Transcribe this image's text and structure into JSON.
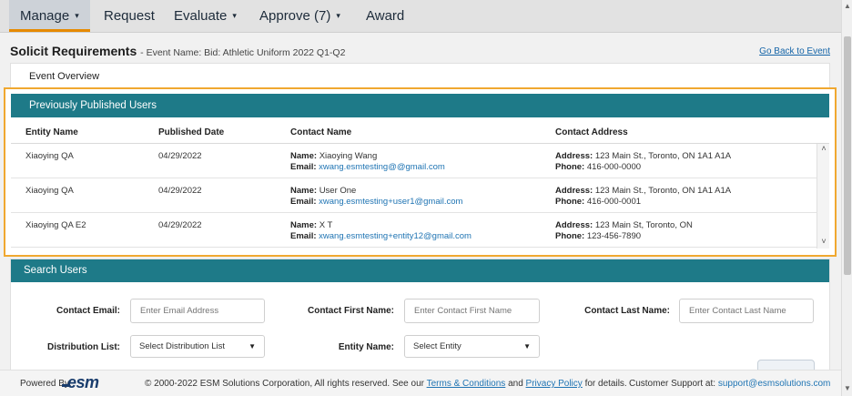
{
  "nav": {
    "items": [
      {
        "label": "Manage",
        "has_caret": true,
        "active": true
      },
      {
        "label": "Request",
        "has_caret": false,
        "active": false
      },
      {
        "label": "Evaluate",
        "has_caret": true,
        "active": false
      },
      {
        "label": "Approve (7)",
        "has_caret": true,
        "active": false
      },
      {
        "label": "Award",
        "has_caret": false,
        "active": false
      }
    ],
    "caret_glyph": "▾"
  },
  "header": {
    "title": "Solicit Requirements",
    "subtitle": "- Event Name: Bid: Athletic Uniform 2022 Q1-Q2",
    "back_link": "Go Back to Event"
  },
  "overview": {
    "label": "Event Overview"
  },
  "published": {
    "title": "Previously Published Users",
    "columns": [
      "Entity Name",
      "Published Date",
      "Contact Name",
      "Contact Address"
    ],
    "name_label": "Name:",
    "email_label": "Email:",
    "address_label": "Address:",
    "phone_label": "Phone:",
    "rows": [
      {
        "entity": "Xiaoying QA",
        "date": "04/29/2022",
        "name": "Xiaoying Wang",
        "email": "xwang.esmtesting@@gmail.com",
        "address": "123 Main St., Toronto, ON 1A1 A1A",
        "phone": "416-000-0000"
      },
      {
        "entity": "Xiaoying QA",
        "date": "04/29/2022",
        "name": "User One",
        "email": "xwang.esmtesting+user1@gmail.com",
        "address": "123 Main St., Toronto, ON 1A1 A1A",
        "phone": "416-000-0001"
      },
      {
        "entity": "Xiaoying QA E2",
        "date": "04/29/2022",
        "name": "X T",
        "email": "xwang.esmtesting+entity12@gmail.com",
        "address": "123 Main St, Toronto, ON",
        "phone": "123-456-7890"
      }
    ]
  },
  "search": {
    "title": "Search Users",
    "contact_email": {
      "label": "Contact Email:",
      "placeholder": "Enter Email Address"
    },
    "first_name": {
      "label": "Contact First Name:",
      "placeholder": "Enter Contact First Name"
    },
    "last_name": {
      "label": "Contact Last Name:",
      "placeholder": "Enter Contact Last Name"
    },
    "distribution_list": {
      "label": "Distribution List:",
      "value": "Select Distribution List"
    },
    "entity_name": {
      "label": "Entity Name:",
      "value": "Select Entity"
    }
  },
  "footer": {
    "powered_by": "Powered By:",
    "logo_text": "esm",
    "copyright_prefix": "© 2000-2022 ESM Solutions Corporation, All rights reserved. See our",
    "terms_link": "Terms & Conditions",
    "and_text": "and",
    "privacy_link": "Privacy Policy",
    "details_text": "for details.",
    "support_label": "Customer Support at:",
    "support_email": "support@esmsolutions.com"
  },
  "colors": {
    "panel_header": "#1e7a88",
    "highlight_border": "#f0a830",
    "active_tab_underline": "#e68a00",
    "link": "#1f74b3"
  }
}
